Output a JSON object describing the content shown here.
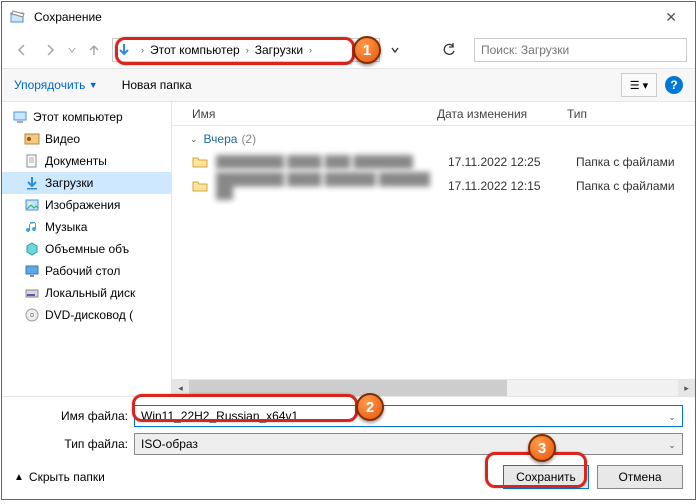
{
  "title": "Сохранение",
  "nav": {
    "crumb1": "Этот компьютер",
    "crumb2": "Загрузки",
    "search_placeholder": "Поиск: Загрузки"
  },
  "toolbar": {
    "organize": "Упорядочить",
    "new_folder": "Новая папка",
    "view_glyph": "☰ ▾",
    "help_glyph": "?"
  },
  "tree": {
    "root": "Этот компьютер",
    "items": [
      "Видео",
      "Документы",
      "Загрузки",
      "Изображения",
      "Музыка",
      "Объемные объ",
      "Рабочий стол",
      "Локальный диск",
      "DVD-дисковод ("
    ]
  },
  "columns": {
    "name": "Имя",
    "date": "Дата изменения",
    "type": "Тип"
  },
  "group": {
    "label": "Вчера",
    "count": "(2)"
  },
  "rows": [
    {
      "name": "████████ ████ ███ ███████",
      "date": "17.11.2022 12:25",
      "type": "Папка с файлами"
    },
    {
      "name": "████████ ████ ██████ ██████ ██",
      "date": "17.11.2022 12:15",
      "type": "Папка с файлами"
    }
  ],
  "fields": {
    "fname_label": "Имя файла:",
    "fname_value": "Win11_22H2_Russian_x64v1",
    "ftype_label": "Тип файла:",
    "ftype_value": "ISO-образ"
  },
  "hide_folders": "Скрыть папки",
  "buttons": {
    "save": "Сохранить",
    "cancel": "Отмена"
  },
  "markers": [
    "1",
    "2",
    "3"
  ]
}
